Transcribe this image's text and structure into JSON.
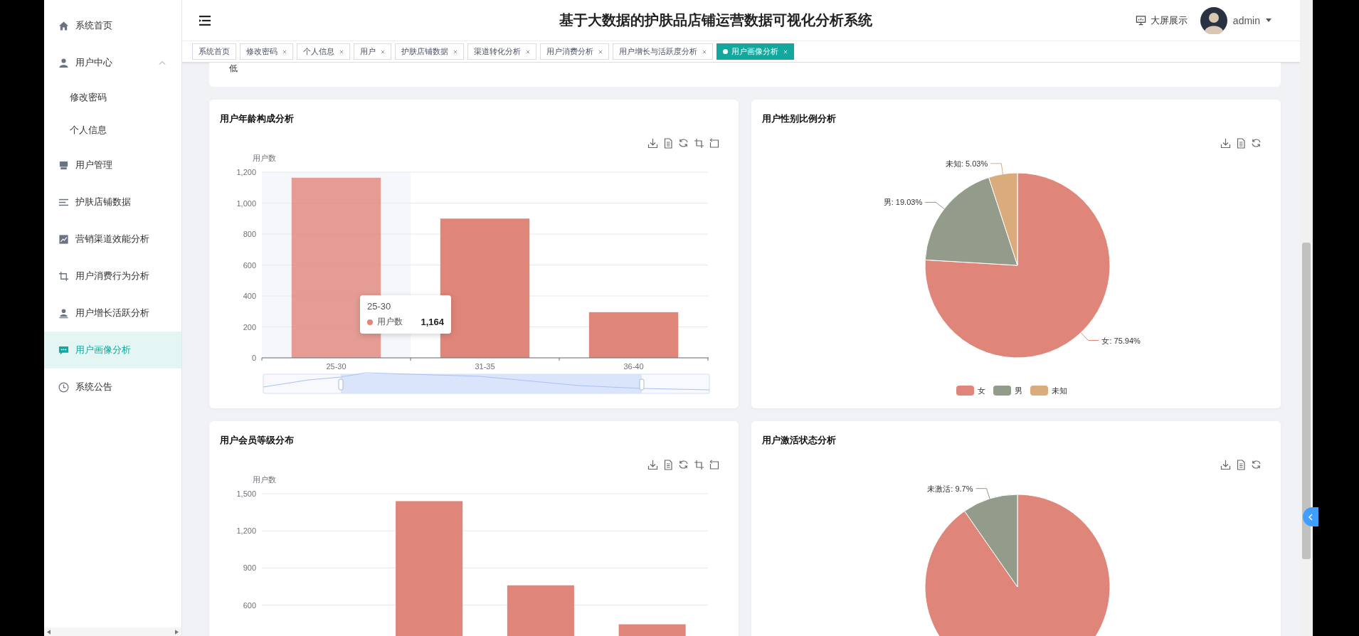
{
  "sidebar": {
    "items": [
      {
        "label": "系统首页",
        "selected": false
      },
      {
        "label": "用户中心",
        "selected": false,
        "expanded": true,
        "children": [
          {
            "label": "修改密码",
            "selected": false
          },
          {
            "label": "个人信息",
            "selected": false
          }
        ]
      },
      {
        "label": "用户管理",
        "selected": false
      },
      {
        "label": "护肤店铺数据",
        "selected": false
      },
      {
        "label": "营销渠道效能分析",
        "selected": false
      },
      {
        "label": "用户消费行为分析",
        "selected": false
      },
      {
        "label": "用户增长活跃分析",
        "selected": false
      },
      {
        "label": "用户画像分析",
        "selected": true
      },
      {
        "label": "系统公告",
        "selected": false
      }
    ]
  },
  "header": {
    "title": "基于大数据的护肤品店铺运营数据可视化分析系统",
    "screen_button": "大屏展示",
    "user": "admin"
  },
  "tabs": [
    {
      "label": "系统首页",
      "closable": false,
      "selected": false
    },
    {
      "label": "修改密码",
      "closable": true,
      "selected": false
    },
    {
      "label": "个人信息",
      "closable": true,
      "selected": false
    },
    {
      "label": "用户",
      "closable": true,
      "selected": false
    },
    {
      "label": "护肤店铺数据",
      "closable": true,
      "selected": false
    },
    {
      "label": "渠道转化分析",
      "closable": true,
      "selected": false
    },
    {
      "label": "用户消费分析",
      "closable": true,
      "selected": false
    },
    {
      "label": "用户增长与活跃度分析",
      "closable": true,
      "selected": false
    },
    {
      "label": "用户画像分析",
      "closable": true,
      "selected": true
    }
  ],
  "top_card": {
    "text": "低"
  },
  "panels": [
    {
      "title": "用户年龄构成分析",
      "zoom_slider": true,
      "highlighted": [
        true,
        false,
        false
      ],
      "tooltip": {
        "title": "25-30",
        "series": "用户数",
        "value": "1,164",
        "color": "#e0857a"
      },
      "chart_data": {
        "type": "bar",
        "grid": true,
        "ylabel": "用户数",
        "categories": [
          "25-30",
          "31-35",
          "36-40"
        ],
        "ylim": [
          0,
          1200
        ],
        "yticks": [
          0,
          200,
          400,
          600,
          800,
          {
            "value": 1000,
            "label": "1,000"
          },
          {
            "value": 1200,
            "label": "1,200"
          }
        ],
        "series": [
          {
            "color": "#e0857a",
            "values": [
              1164,
              900,
              295
            ]
          }
        ]
      }
    },
    {
      "title": "用户性别比例分析",
      "chart_data": {
        "type": "pie",
        "legend": "bottom",
        "categories": [
          "女",
          "男",
          "未知"
        ],
        "values": [
          75.94,
          19.03,
          5.03
        ],
        "colors": [
          "#e0857a",
          "#939b8b",
          "#d9ab7d"
        ],
        "value_labels": [
          "女: 75.94%",
          "男: 19.03%",
          "未知: 5.03%"
        ]
      }
    },
    {
      "title": "用户会员等级分布",
      "chart_data": {
        "type": "bar",
        "grid": true,
        "ylabel": "用户数",
        "ylim": [
          0,
          1500
        ],
        "yticks": [
          600,
          900,
          {
            "value": 1200,
            "label": "1,200"
          },
          {
            "value": 1500,
            "label": "1,500"
          }
        ],
        "series": [
          {
            "color": "#e0857a",
            "values": [
              null,
              1440,
              760,
              445
            ]
          }
        ]
      }
    },
    {
      "title": "用户激活状态分析",
      "chart_data": {
        "type": "pie",
        "values": [
          90.3,
          9.7
        ],
        "colors": [
          "#e0857a",
          "#939b8b"
        ],
        "value_labels": [
          null,
          "未激活: 9.7%"
        ]
      }
    }
  ]
}
